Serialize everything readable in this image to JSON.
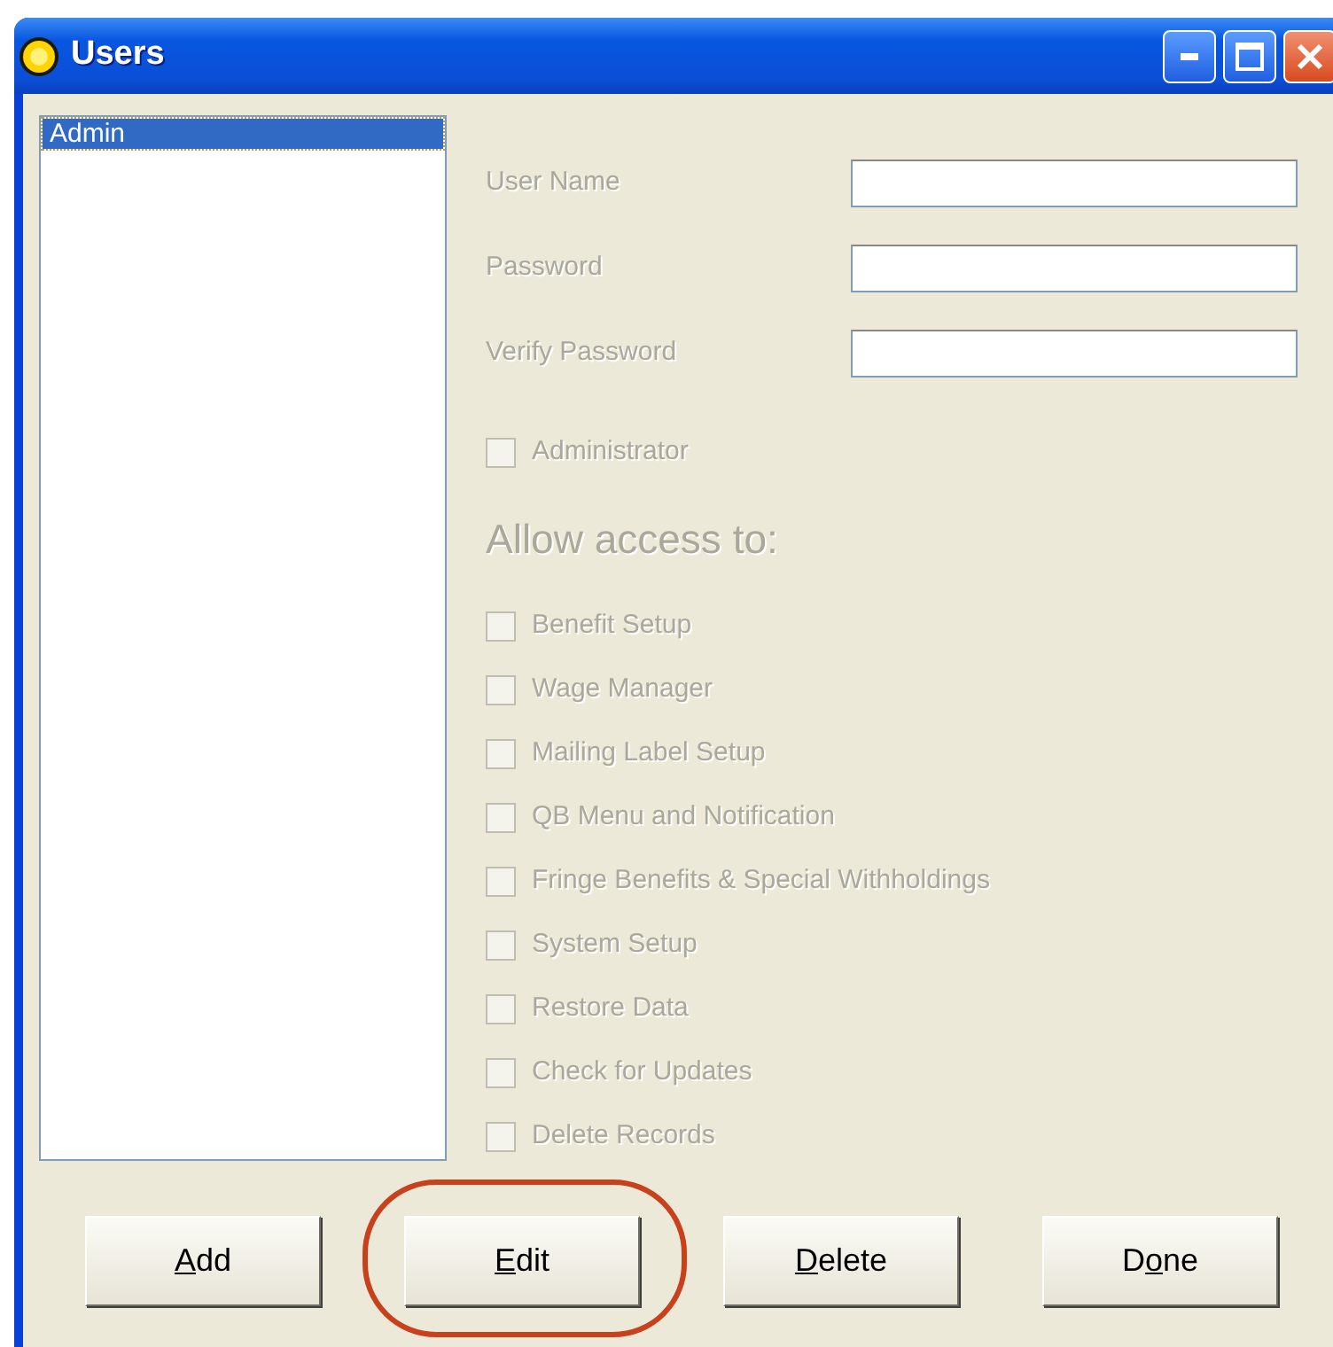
{
  "window": {
    "title": "Users"
  },
  "user_list": [
    {
      "name": "Admin",
      "selected": true
    }
  ],
  "fields": [
    {
      "label": "User Name",
      "disabled": true
    },
    {
      "label": "Password",
      "disabled": true
    },
    {
      "label": "Verify Password",
      "disabled": true
    }
  ],
  "administrator": {
    "label": "Administrator",
    "checked": false,
    "disabled": true
  },
  "access_heading": "Allow access to:",
  "access": [
    {
      "label": "Benefit Setup",
      "checked": false,
      "disabled": true
    },
    {
      "label": "Wage Manager",
      "checked": false,
      "disabled": true
    },
    {
      "label": "Mailing Label Setup",
      "checked": false,
      "disabled": true
    },
    {
      "label": "QB Menu and Notification",
      "checked": false,
      "disabled": true
    },
    {
      "label": "Fringe Benefits & Special Withholdings",
      "checked": false,
      "disabled": true
    },
    {
      "label": "System Setup",
      "checked": false,
      "disabled": true
    },
    {
      "label": "Restore Data",
      "checked": false,
      "disabled": true
    },
    {
      "label": "Check for Updates",
      "checked": false,
      "disabled": true
    },
    {
      "label": "Delete Records",
      "checked": false,
      "disabled": true
    }
  ],
  "buttons": [
    {
      "key": "A",
      "after": "dd",
      "circled": false
    },
    {
      "key": "E",
      "after": "dit",
      "circled": true
    },
    {
      "key": "D",
      "after": "elete",
      "circled": false
    },
    {
      "before": "D",
      "key": "o",
      "after": "ne",
      "circled": false
    }
  ]
}
